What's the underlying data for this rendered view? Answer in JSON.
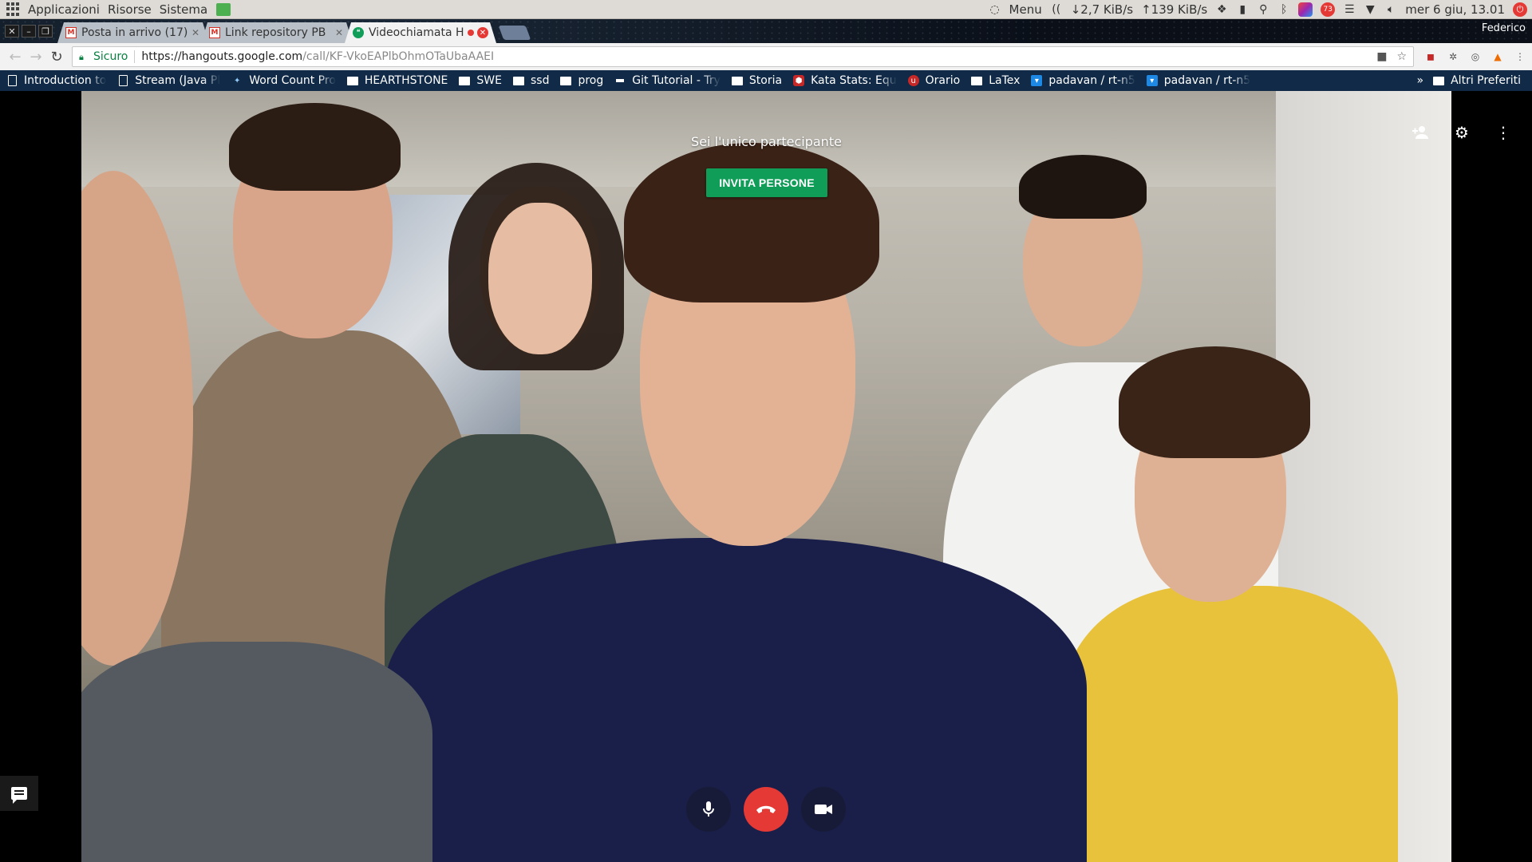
{
  "system_panel": {
    "menus": [
      "Applicazioni",
      "Risorse",
      "Sistema"
    ],
    "menu_label": "Menu",
    "net_down": "↓2,7 KiB/s",
    "net_up": "↑139 KiB/s",
    "notify_count": "73",
    "datetime": "mer 6 giu, 13.01"
  },
  "tabs": [
    {
      "title": "Posta in arrivo (17)",
      "favicon": "gmail-icon",
      "state": "inactive"
    },
    {
      "title": "Link repository PB",
      "favicon": "gmail-icon",
      "state": "inactive"
    },
    {
      "title": "Videochiamata H",
      "favicon": "hangouts-icon",
      "state": "active"
    }
  ],
  "profile_name": "Federico",
  "omnibox": {
    "secure_label": "Sicuro",
    "url_scheme_host": "https://hangouts.google.com",
    "url_path": "/call/KF-VkoEAPlbOhmOTaUbaAAEI"
  },
  "bookmarks": [
    {
      "label": "Introduction to",
      "icon": "page"
    },
    {
      "label": "Stream (Java Pl",
      "icon": "page"
    },
    {
      "label": "Word Count Pro",
      "icon": "page"
    },
    {
      "label": "HEARTHSTONE",
      "icon": "folder"
    },
    {
      "label": "SWE",
      "icon": "folder"
    },
    {
      "label": "ssd",
      "icon": "folder"
    },
    {
      "label": "prog",
      "icon": "folder"
    },
    {
      "label": "Git Tutorial - Try",
      "icon": "dark"
    },
    {
      "label": "Storia",
      "icon": "folder"
    },
    {
      "label": "Kata Stats: Equ",
      "icon": "red"
    },
    {
      "label": "Orario",
      "icon": "red"
    },
    {
      "label": "LaTex",
      "icon": "folder"
    },
    {
      "label": "padavan / rt-n5",
      "icon": "blue"
    },
    {
      "label": "padavan / rt-n5",
      "icon": "blue"
    }
  ],
  "bookmarks_more": "»",
  "bookmarks_other": "Altri Preferiti",
  "call": {
    "status_text": "Sei l'unico partecipante",
    "invite_label": "INVITA PERSONE"
  },
  "colors": {
    "invite_green": "#0f9d58",
    "hangup_red": "#e53935",
    "bookmarks_bg": "#102a47"
  }
}
